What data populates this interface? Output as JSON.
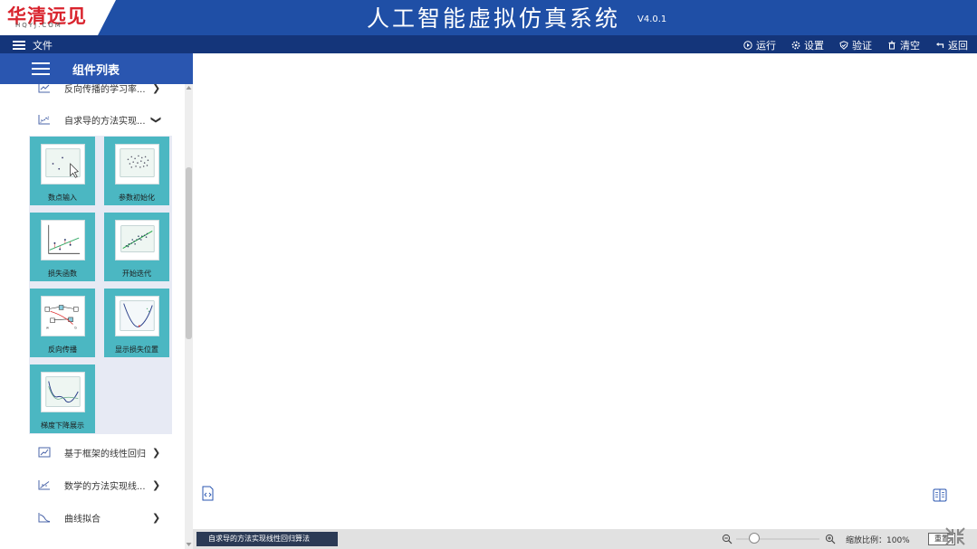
{
  "header": {
    "logo_text": "华清远见",
    "logo_sub": "HQYJ.COM",
    "title": "人工智能虚拟仿真系统",
    "version": "V4.0.1"
  },
  "menubar": {
    "file_label": "文件",
    "actions": [
      {
        "icon": "play-circle-icon",
        "label": "运行"
      },
      {
        "icon": "gear-icon",
        "label": "设置"
      },
      {
        "icon": "shield-check-icon",
        "label": "验证"
      },
      {
        "icon": "trash-icon",
        "label": "清空"
      },
      {
        "icon": "return-arrow-icon",
        "label": "返回"
      }
    ]
  },
  "sidebar": {
    "title": "组件列表",
    "categories": [
      {
        "label": "反向传播的学习率...",
        "expanded": false
      },
      {
        "label": "自求导的方法实现...",
        "expanded": true
      },
      {
        "label": "基于框架的线性回归",
        "expanded": false
      },
      {
        "label": "数学的方法实现线...",
        "expanded": false
      },
      {
        "label": "曲线拟合",
        "expanded": false
      }
    ],
    "cards": [
      {
        "label": "数点输入",
        "icon": "scatter-input-icon"
      },
      {
        "label": "参数初始化",
        "icon": "scatter-cluster-icon"
      },
      {
        "label": "损失函数",
        "icon": "loss-function-icon"
      },
      {
        "label": "开始迭代",
        "icon": "regression-line-icon"
      },
      {
        "label": "反向传播",
        "icon": "backprop-graph-icon"
      },
      {
        "label": "显示损失位置",
        "icon": "loss-curve-icon"
      },
      {
        "label": "梯度下降展示",
        "icon": "gradient-descent-icon"
      }
    ]
  },
  "statusbar": {
    "active_tab": "自求导的方法实现线性回归算法",
    "zoom_label": "缩放比例：100%",
    "zoom_value": 1.0,
    "reset_label": "重置"
  },
  "colors": {
    "title_bar": "#1f4fa6",
    "menu_bar": "#14357a",
    "sidebar_header": "#2a56b0",
    "card": "#4bb7c2",
    "logo": "#d9232d"
  }
}
